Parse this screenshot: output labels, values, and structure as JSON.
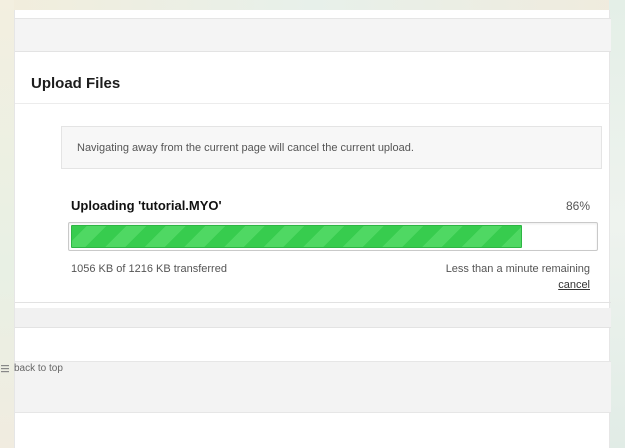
{
  "page": {
    "title": "Upload Files"
  },
  "notice": {
    "text": "Navigating away from the current page will cancel the current upload."
  },
  "upload": {
    "label": "Uploading 'tutorial.MYO'",
    "percent_text": "86%",
    "progress_fraction": 0.86,
    "transferred_text": "1056 KB of 1216 KB transferred",
    "remaining_text": "Less than a minute remaining",
    "cancel_label": "cancel",
    "colors": {
      "fill": "#4fd863",
      "fill_stripe": "#37cc4e",
      "fill_border": "#2eb544"
    }
  },
  "footer": {
    "back_to_top_label": "back to top",
    "back_to_top_icon": "arrow-up-lines-icon"
  }
}
